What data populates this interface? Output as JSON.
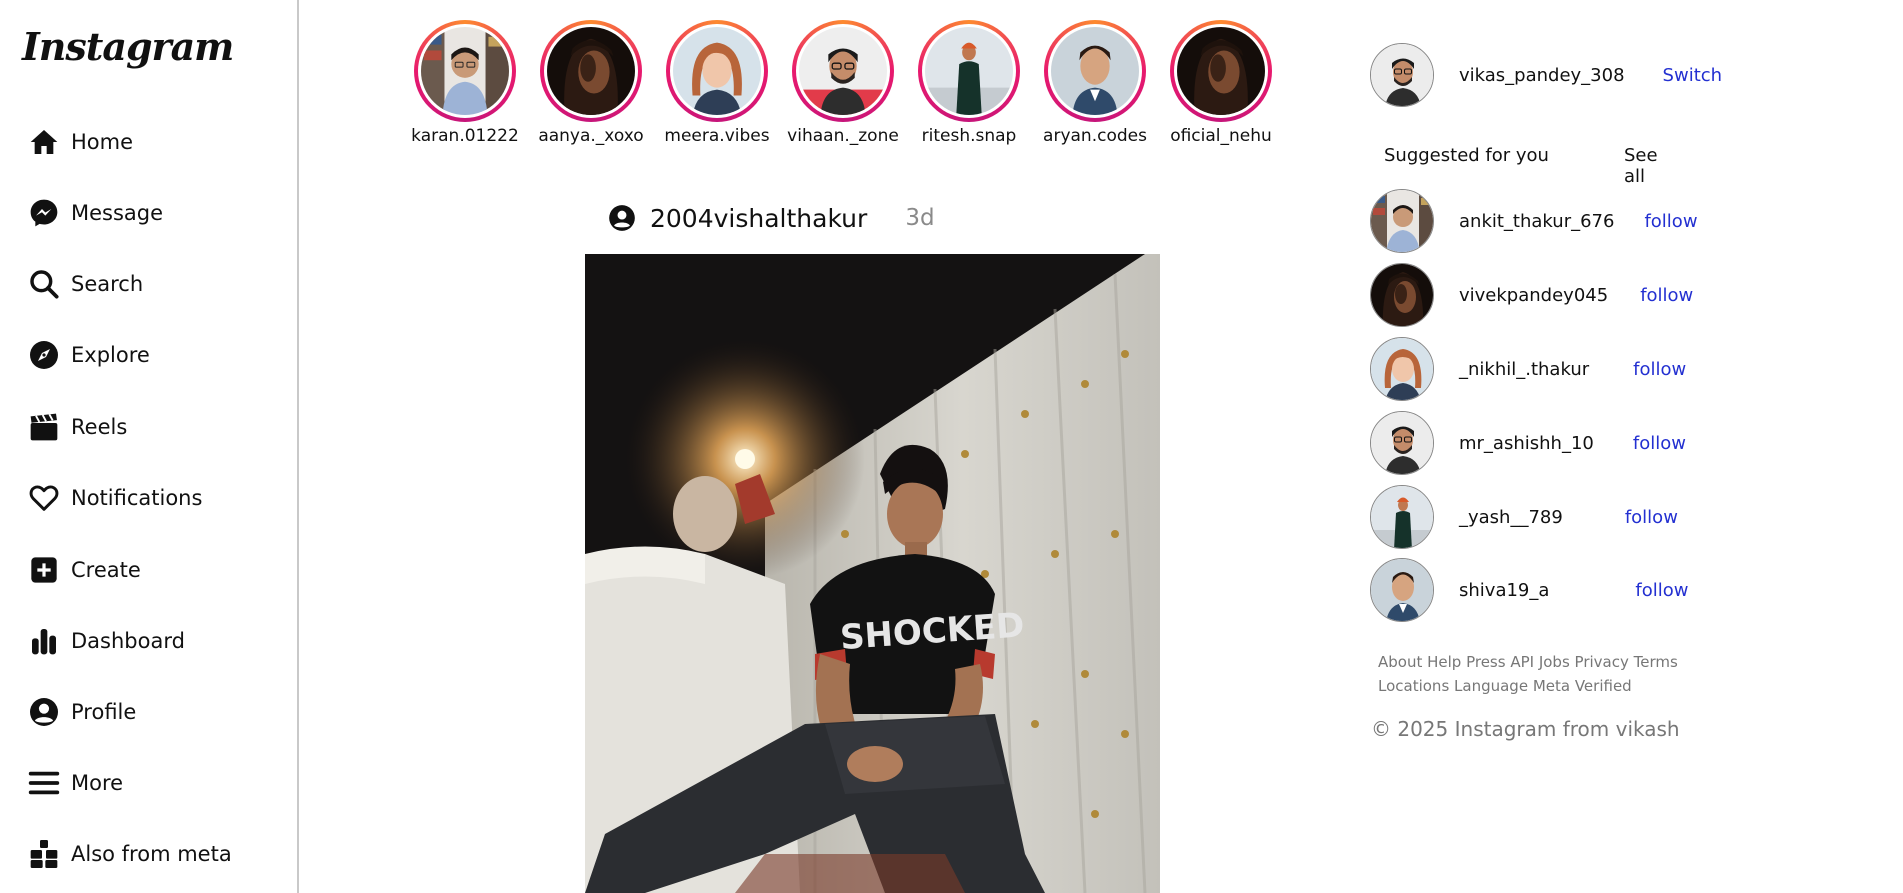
{
  "app": {
    "logo_text": "Instagram"
  },
  "sidebar": {
    "items": [
      {
        "label": "Home",
        "icon": "home-icon"
      },
      {
        "label": "Message",
        "icon": "messenger-icon"
      },
      {
        "label": "Search",
        "icon": "search-icon"
      },
      {
        "label": "Explore",
        "icon": "compass-icon"
      },
      {
        "label": "Reels",
        "icon": "clapperboard-icon"
      },
      {
        "label": "Notifications",
        "icon": "heart-icon"
      },
      {
        "label": "Create",
        "icon": "plus-square-icon"
      },
      {
        "label": "Dashboard",
        "icon": "bar-chart-icon"
      },
      {
        "label": "Profile",
        "icon": "user-circle-icon"
      },
      {
        "label": "More",
        "icon": "menu-icon"
      },
      {
        "label": "Also from meta",
        "icon": "blocks-icon"
      }
    ]
  },
  "stories": [
    {
      "name": "karan.01222"
    },
    {
      "name": "aanya._xoxo"
    },
    {
      "name": "meera.vibes"
    },
    {
      "name": "vihaan._zone"
    },
    {
      "name": "ritesh.snap"
    },
    {
      "name": "aryan.codes"
    },
    {
      "name": "oficial_nehu"
    }
  ],
  "post": {
    "username": "2004vishalthakur",
    "time": "3d",
    "shirt_text": "SHOCKED"
  },
  "right_panel": {
    "current_user": "vikas_pandey_308",
    "switch_label": "Switch",
    "suggested_title": "Suggested for you",
    "see_all_label": "See all",
    "suggestions": [
      {
        "name": "ankit_thakur_676",
        "action": "follow"
      },
      {
        "name": "vivekpandey045",
        "action": "follow"
      },
      {
        "name": "_nikhil_.thakur",
        "action": "follow"
      },
      {
        "name": "mr_ashishh_10",
        "action": "follow"
      },
      {
        "name": "_yash__789",
        "action": "follow"
      },
      {
        "name": "shiva19_a",
        "action": "follow"
      }
    ],
    "footer_line1": "About Help Press API Jobs Privacy Terms",
    "footer_line2": "Locations Language Meta Verified",
    "copyright": "© 2025 Instagram from vikash"
  },
  "colors": {
    "link_blue": "#2330d1",
    "story_ring_pink": "#e8196e",
    "story_ring_orange": "#fd8a2f",
    "muted_text": "#777777"
  }
}
